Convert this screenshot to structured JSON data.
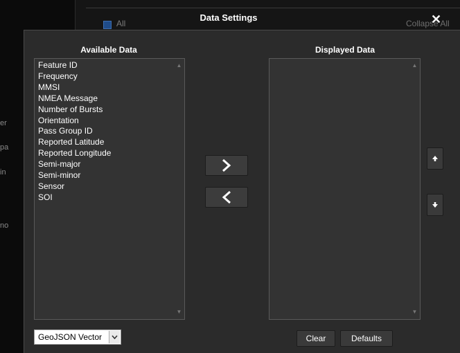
{
  "background": {
    "all_label": "All",
    "collapse_label": "Collapse All",
    "edge_fragments": [
      "er",
      "pa",
      "in",
      "no"
    ]
  },
  "dialog": {
    "title": "Data Settings",
    "close_glyph": "✕"
  },
  "available": {
    "heading": "Available Data",
    "items": [
      "Feature ID",
      "Frequency",
      "MMSI",
      "NMEA Message",
      "Number of Bursts",
      "Orientation",
      "Pass Group ID",
      "Reported Latitude",
      "Reported Longitude",
      "Semi-major",
      "Semi-minor",
      "Sensor",
      "SOI"
    ]
  },
  "displayed": {
    "heading": "Displayed Data",
    "items": []
  },
  "controls": {
    "add_icon": "chevron-right-icon",
    "remove_icon": "chevron-left-icon",
    "move_up_icon": "arrow-up-icon",
    "move_down_icon": "arrow-down-icon"
  },
  "footer": {
    "format_value": "GeoJSON Vector",
    "clear_label": "Clear",
    "defaults_label": "Defaults"
  }
}
